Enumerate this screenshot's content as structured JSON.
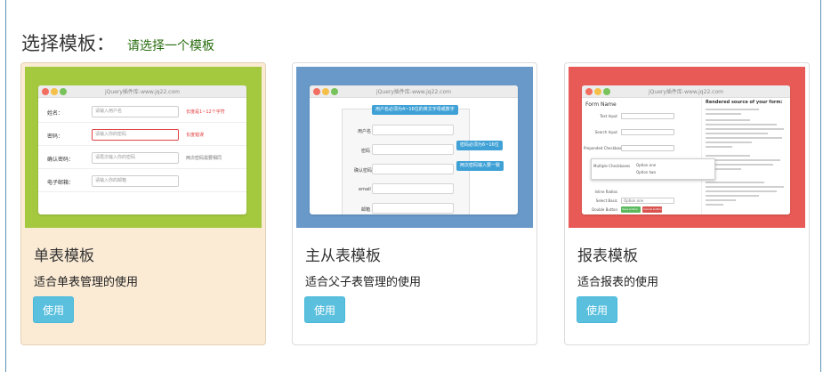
{
  "heading": {
    "title": "选择模板：",
    "subtitle": "请选择一个模板"
  },
  "cards": [
    {
      "title": "单表模板",
      "desc": "适合单表管理的使用",
      "button": "使用",
      "selected": true,
      "thumb_bg": "#a4c93f",
      "mock": {
        "url": "jQuery插件库-www.jq22.com",
        "rows": [
          {
            "label": "姓名：",
            "placeholder": "请输入用户名",
            "hint": "长度是1~12个字符"
          },
          {
            "label": "密码：",
            "placeholder": "请输入你的密码",
            "hint": "长度错误"
          },
          {
            "label": "确认密码：",
            "placeholder": "请再次输入你的密码",
            "hint": "两次密码需要相同"
          },
          {
            "label": "电子邮箱：",
            "placeholder": "请输入你的邮箱",
            "hint": ""
          }
        ]
      }
    },
    {
      "title": "主从表模板",
      "desc": "适合父子表管理的使用",
      "button": "使用",
      "selected": false,
      "thumb_bg": "#6899c9",
      "mock": {
        "url": "jQuery插件库-www.jq22.com",
        "tips": [
          "用户名必须为4~16位的英文字母或数字",
          "密码必须为6~16位",
          "两次密码输入要一致"
        ],
        "rows": [
          "用户名",
          "密码",
          "确认密码",
          "email",
          "邮箱"
        ]
      }
    },
    {
      "title": "报表模板",
      "desc": "适合报表的使用",
      "button": "使用",
      "selected": false,
      "thumb_bg": "#e85a55",
      "mock": {
        "url": "jQuery插件库-www.jq22.com",
        "form_title": "Form Name",
        "source_title": "Rendered source of your form:",
        "labels": [
          "Text Input",
          "Search Input",
          "Prepended Checkbox",
          "Multiple Checkboxes",
          "Inline Radios",
          "Select Basic",
          "Double Button"
        ],
        "popup_options": [
          "Option one",
          "Option two"
        ],
        "select_value": "Option one",
        "btn_ok": "Save button",
        "btn_cancel": "Cancel button"
      }
    }
  ]
}
